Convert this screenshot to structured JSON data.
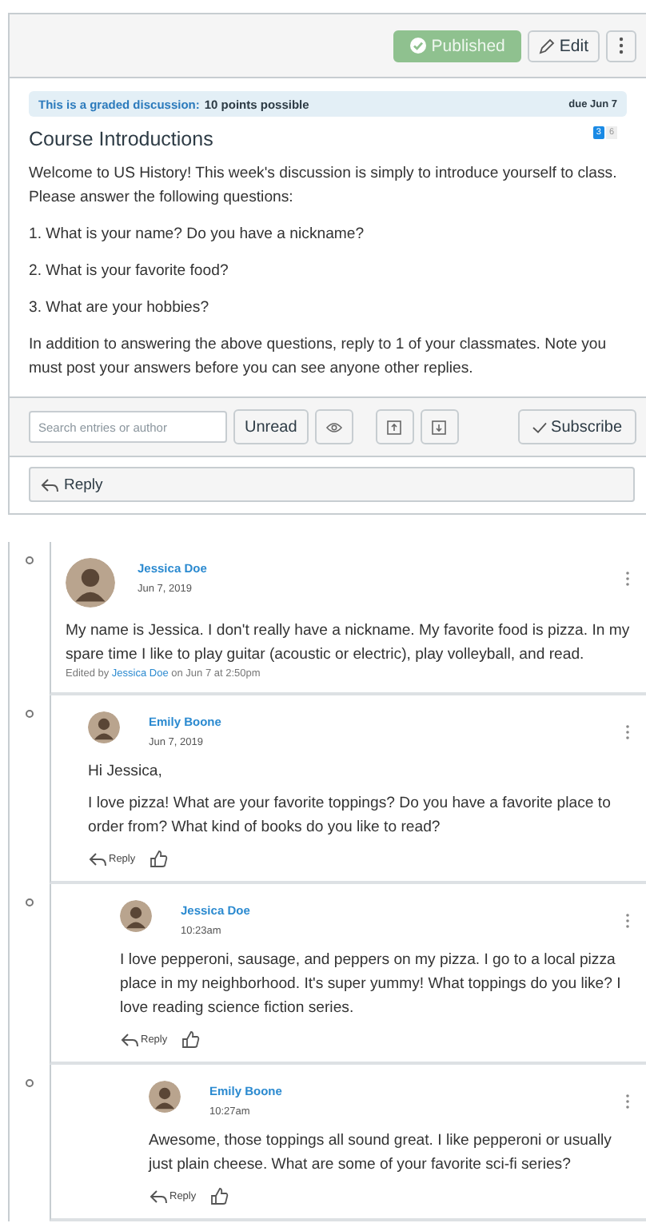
{
  "header": {
    "buttons": [
      {
        "kind": "published",
        "label": "Published"
      },
      {
        "kind": "edit",
        "label": "Edit"
      },
      {
        "kind": "more"
      }
    ]
  },
  "graded_banner": {
    "label": "This is a graded discussion:",
    "points": "10 points possible",
    "due": "due Jun 7"
  },
  "topic": {
    "title": "Course Introductions",
    "unread_count": "3",
    "total_count": "6",
    "paragraphs": [
      "Welcome to US History! This week's discussion is simply to introduce yourself to class. Please answer the following questions:",
      "1. What is your name? Do you have a nickname?",
      "2. What is your favorite food?",
      "3. What are your hobbies?",
      "In addition to answering the above questions, reply to 1 of your classmates. Note you must post your answers before you can see anyone other replies."
    ]
  },
  "toolbar": {
    "search": {
      "placeholder": "Search entries or author"
    },
    "unread_button": "Unread",
    "subscribe_button": "Subscribe"
  },
  "reply_bar": {
    "label": "Reply"
  },
  "entries": [
    {
      "author": "Jessica Doe",
      "date": "Jun 7, 2019",
      "read": true,
      "paragraphs": [
        "My name is Jessica. I don't really have a nickname. My favorite food is pizza. In my spare time I like to play guitar (acoustic or electric), play volleyball, and read."
      ],
      "edited": {
        "prefix": "Edited by",
        "author": "Jessica Doe",
        "suffix": "on Jun 7 at 2:50pm"
      },
      "children": [
        {
          "author": "Emily Boone",
          "date": "Jun 7, 2019",
          "read": true,
          "paragraphs": [
            "Hi Jessica,",
            "I love pizza! What are your favorite toppings? Do you have a favorite place to order from? What kind of books do you like to read?"
          ],
          "reply_label": "Reply",
          "children": [
            {
              "author": "Jessica Doe",
              "date": "10:23am",
              "read": true,
              "paragraphs": [
                "I love pepperoni, sausage, and peppers on my pizza. I go to a local pizza place in my neighborhood. It's super yummy! What toppings do you like? I love reading science fiction series."
              ],
              "reply_label": "Reply",
              "children": [
                {
                  "author": "Emily Boone",
                  "date": "10:27am",
                  "read": true,
                  "paragraphs": [
                    "Awesome, those toppings all sound great. I like pepperoni or usually just plain cheese. What are some of your favorite sci-fi series?"
                  ],
                  "reply_label": "Reply"
                }
              ]
            }
          ]
        }
      ]
    }
  ]
}
